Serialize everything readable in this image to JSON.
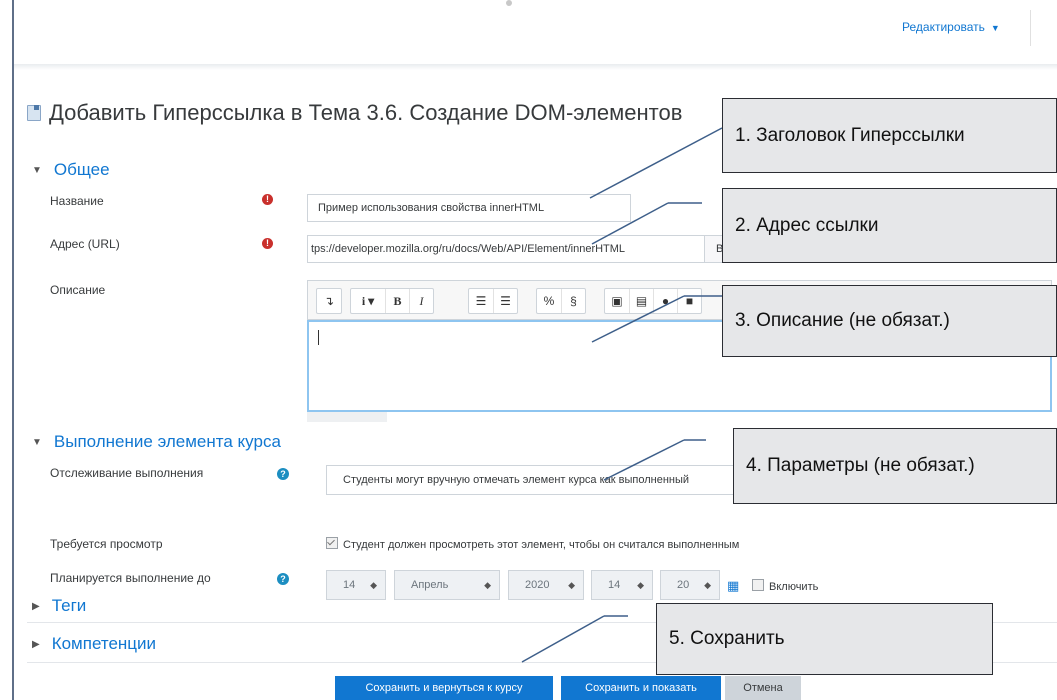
{
  "topbar": {
    "edit_label": "Редактировать"
  },
  "page": {
    "title": "Добавить Гиперссылка в Тема 3.6. Создание DOM-элементов"
  },
  "general": {
    "section_title": "Общее",
    "name_label": "Название",
    "name_value": "Пример использования свойства innerHTML",
    "url_label": "Адрес (URL)",
    "url_value": "tps://developer.mozilla.org/ru/docs/Web/API/Element/innerHTML",
    "choose_link_label": "Выбрать ссылку...",
    "description_label": "Описание"
  },
  "editor": {
    "toolbar": [
      "insert-toggle",
      "info",
      "bold",
      "italic",
      "unordered-list",
      "ordered-list",
      "link",
      "unlink",
      "image",
      "media",
      "record-audio",
      "record-video"
    ]
  },
  "completion": {
    "section_title": "Выполнение элемента курса",
    "tracking_label": "Отслеживание выполнения",
    "tracking_value": "Студенты могут вручную отмечать элемент курса как выполненный",
    "view_label": "Требуется просмотр",
    "view_checkbox_label": "Студент должен просмотреть этот элемент, чтобы он считался выполненным",
    "expected_label": "Планируется выполнение до",
    "day": "14",
    "month": "Апрель",
    "year": "2020",
    "hour": "14",
    "minute": "20",
    "enable_label": "Включить"
  },
  "tags": {
    "section_title": "Теги"
  },
  "competencies": {
    "section_title": "Компетенции"
  },
  "buttons": {
    "save_return": "Сохранить и вернуться к курсу",
    "save_display": "Сохранить и показать",
    "cancel": "Отмена"
  },
  "annotations": {
    "a1": "1. Заголовок Гиперссылки",
    "a2": "2. Адрес ссылки",
    "a3": "3. Описание (не обязат.)",
    "a4": "4. Параметры (не обязат.)",
    "a5": "5. Сохранить"
  },
  "colors": {
    "accent": "#1177d1",
    "required": "#c9302c",
    "callout_bg": "#e6e7e9"
  }
}
